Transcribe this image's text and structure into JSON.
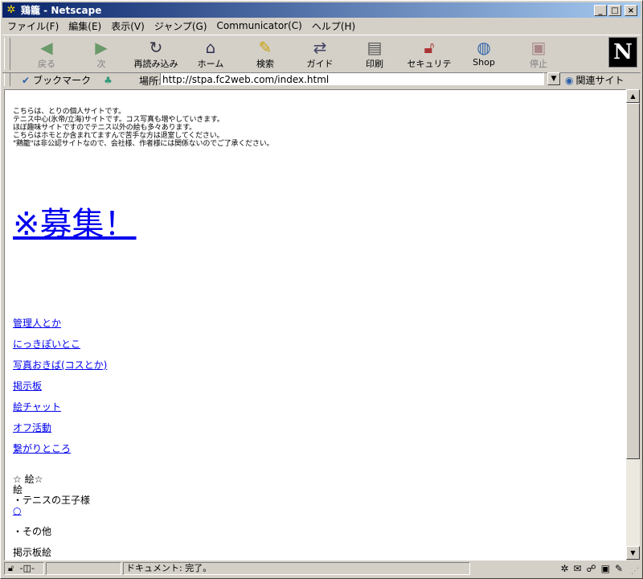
{
  "window": {
    "title": "鶏籠 - Netscape"
  },
  "menu": [
    "ファイル(F)",
    "編集(E)",
    "表示(V)",
    "ジャンプ(G)",
    "Communicator(C)",
    "ヘルプ(H)"
  ],
  "toolbar": {
    "back": "戻る",
    "forward": "次",
    "reload": "再読み込み",
    "home": "ホーム",
    "search": "検索",
    "guide": "ガイド",
    "print": "印刷",
    "security": "セキュリティ",
    "shop": "Shop",
    "stop": "停止",
    "logo": "N"
  },
  "location": {
    "bookmarks_label": "ブックマーク",
    "label": "場所:",
    "url": "http://stpa.fc2web.com/index.html",
    "related_label": "関連サイト"
  },
  "content": {
    "intro": [
      "こちらは、とりの個人サイトです。",
      "テニス中心(氷帝/立海)サイトです。コス写真も増やしていきます。",
      "ほぼ趣味サイトですのでテニス以外の絵も多々あります。",
      "こちらはホモとか含まれてますんで苦手な方は退室してください。",
      "\"鶏籠\"は非公認サイトなので、会社様、作者様には関係ないのでご了承ください。"
    ],
    "recruit_link": "※募集！",
    "nav_links": [
      "管理人とか",
      "にっきぽいとこ",
      "写真おきば(コスとか)",
      "掲示板",
      "絵チャット",
      "オフ活動",
      "繋がりところ"
    ],
    "art_heading": "☆ 絵☆",
    "art_sub": "絵",
    "art_item1": "・テニスの王子様",
    "art_item1_link": "○",
    "art_item2": "・その他",
    "art_item3": "掲示板絵"
  },
  "status": {
    "text": "ドキュメント: 完了。"
  }
}
